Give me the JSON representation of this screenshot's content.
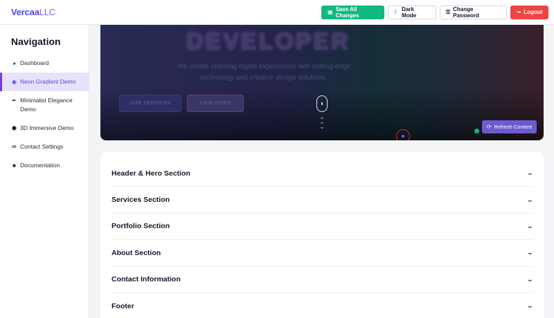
{
  "header": {
    "brand_main": "Vercaa",
    "brand_suffix": "LLC",
    "save_label": "Save All Changes",
    "dark_label": "Dark Mode",
    "password_label": "Change Password",
    "logout_label": "Logout"
  },
  "sidebar": {
    "title": "Navigation",
    "items": [
      {
        "label": "Dashboard",
        "icon": "dashboard-icon"
      },
      {
        "label": "Neon Gradient Demo",
        "icon": "palette-icon",
        "active": true
      },
      {
        "label": "Minimalist Elegance Demo",
        "icon": "feather-icon"
      },
      {
        "label": "3D Immersive Demo",
        "icon": "cube-icon"
      },
      {
        "label": "Contact Settings",
        "icon": "envelope-icon"
      },
      {
        "label": "Documentation",
        "icon": "book-icon"
      }
    ]
  },
  "hero": {
    "heading": "DEVELOPER",
    "subtitle": "We create stunning digital experiences with cutting-edge technology and creative design solutions.",
    "button_services": "OUR SERVICES",
    "button_work": "VIEW WORK",
    "refresh_label": "Refresh Content"
  },
  "accordion": {
    "sections": [
      "Header & Hero Section",
      "Services Section",
      "Portfolio Section",
      "About Section",
      "Contact Information",
      "Footer"
    ]
  },
  "colors": {
    "accent": "#4f46e5",
    "save": "#10b981",
    "logout": "#ef4444",
    "active_nav_bg": "#e7e2fb",
    "refresh": "#6d5bd0"
  }
}
